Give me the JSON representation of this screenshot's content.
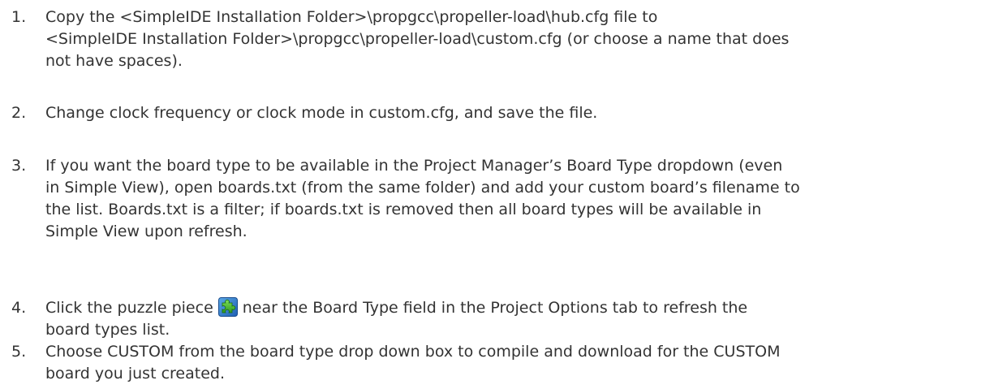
{
  "steps": [
    {
      "number": "1.",
      "lines": [
        "Copy the <SimpleIDE Installation Folder>\\propgcc\\propeller-load\\hub.cfg file to",
        "<SimpleIDE Installation Folder>\\propgcc\\propeller-load\\custom.cfg (or choose a name that does",
        "not have spaces)."
      ]
    },
    {
      "number": "2.",
      "lines": [
        "Change clock frequency or clock mode in custom.cfg, and save the file."
      ]
    },
    {
      "number": "3.",
      "lines": [
        "If you want the board type to be available in the Project Manager’s Board Type dropdown (even",
        "in Simple View), open boards.txt (from the same folder) and add your custom board’s filename to",
        "the list. Boards.txt is a filter; if boards.txt is removed then all board types will be available in",
        "Simple View upon refresh."
      ]
    },
    {
      "number": "4.",
      "line1_before_icon": "Click the puzzle piece",
      "line1_after_icon": "near the Board Type field in the Project Options tab to refresh the",
      "line2": "board types list.",
      "icon": "puzzle-piece-icon"
    },
    {
      "number": "5.",
      "lines": [
        "Choose CUSTOM from the board type drop down box to compile and download for the CUSTOM",
        "board you just created."
      ]
    }
  ]
}
